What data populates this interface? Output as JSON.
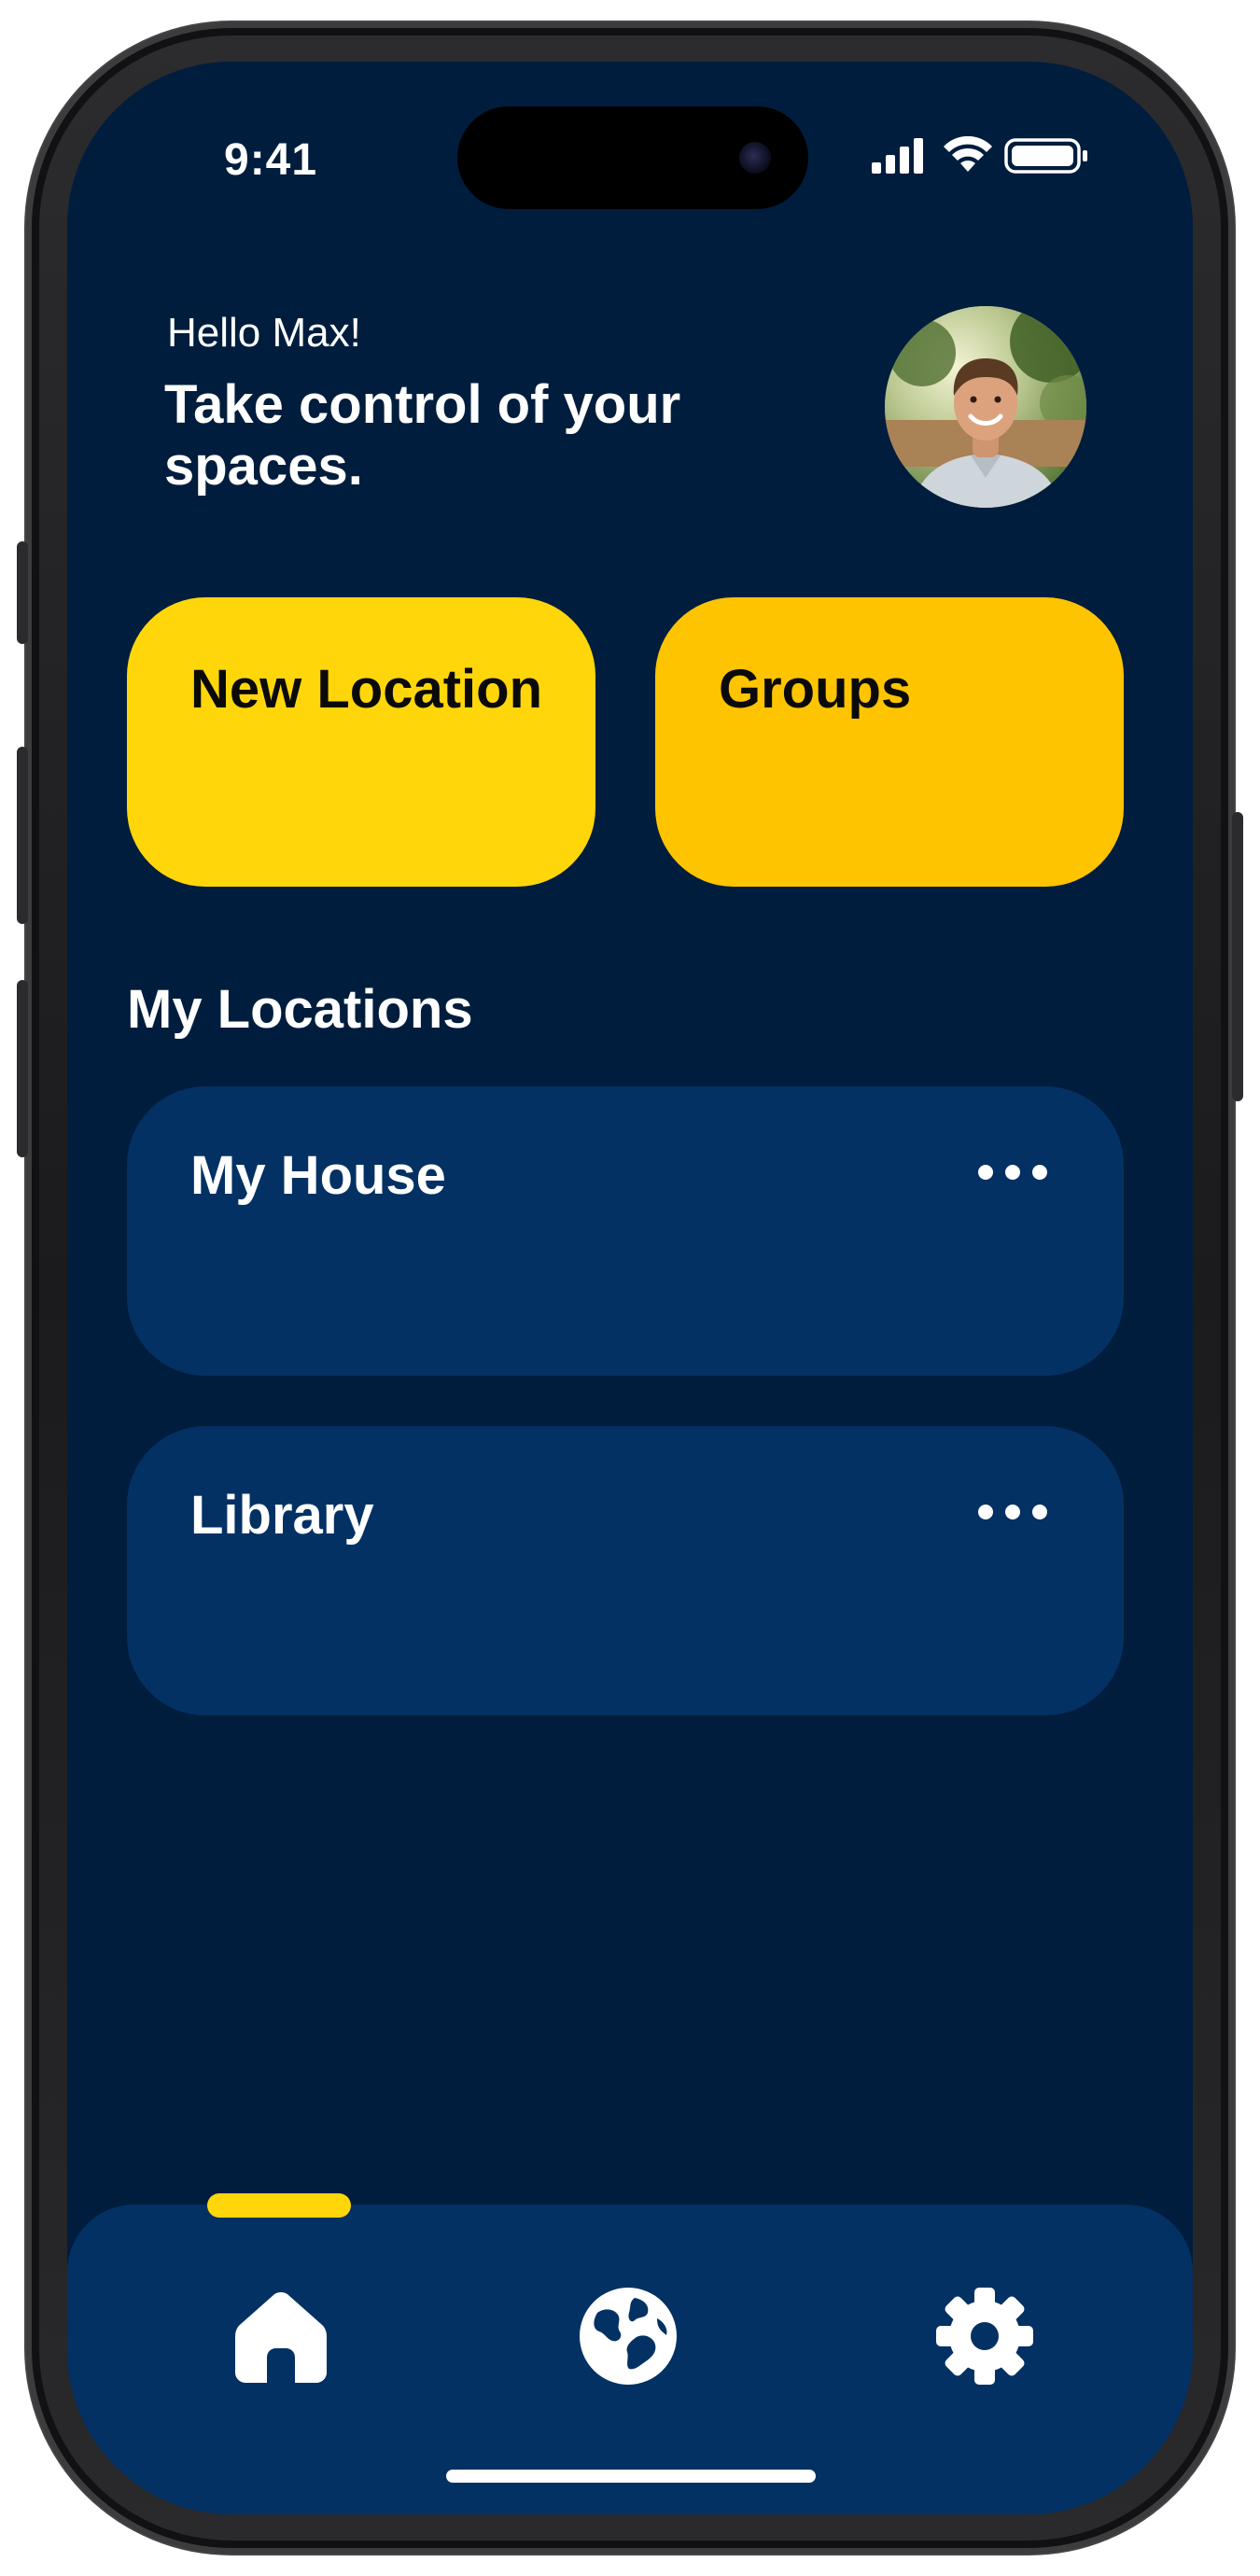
{
  "status_bar": {
    "time": "9:41",
    "icons": [
      "signal-icon",
      "wifi-icon",
      "battery-icon"
    ]
  },
  "header": {
    "greeting": "Hello Max!",
    "tagline": "Take control of your spaces."
  },
  "actions": {
    "new_location_label": "New Location",
    "groups_label": "Groups"
  },
  "my_locations": {
    "title": "My Locations",
    "items": [
      {
        "name": "My House"
      },
      {
        "name": "Library"
      }
    ]
  },
  "tab_bar": {
    "tabs": [
      {
        "icon": "home-icon",
        "active": true
      },
      {
        "icon": "globe-icon",
        "active": false
      },
      {
        "icon": "gear-icon",
        "active": false
      }
    ]
  },
  "colors": {
    "background": "#011d3d",
    "card": "#033163",
    "accent_yellow": "#ffd60a",
    "accent_amber": "#ffc400",
    "text_primary": "#ffffff",
    "text_dark": "#0a0a0a"
  }
}
